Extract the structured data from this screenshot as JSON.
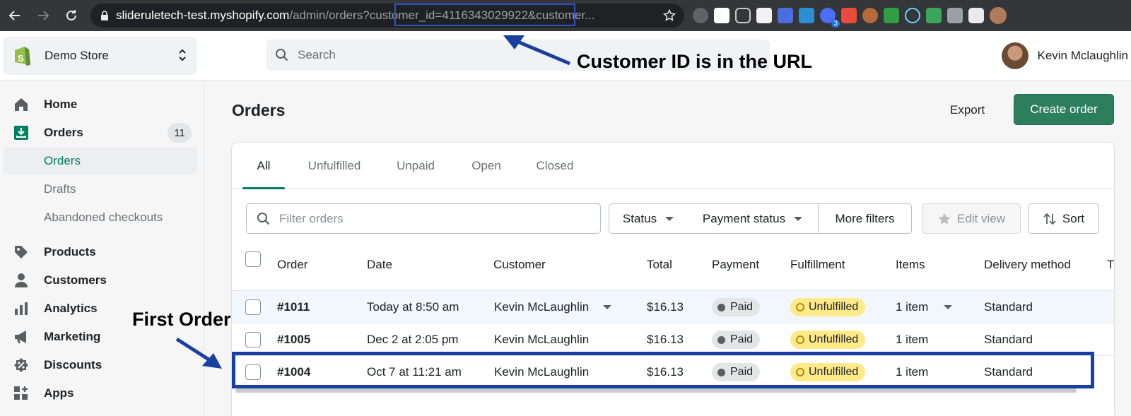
{
  "browser": {
    "url_host": "slideruletech-test.myshopify.com",
    "url_path": "/admin/orders?",
    "url_highlight": "customer_id=4116343029922",
    "url_rest": "&customer...",
    "ext_badge": "3"
  },
  "store": {
    "name": "Demo Store"
  },
  "search": {
    "placeholder": "Search"
  },
  "user": {
    "name": "Kevin Mclaughlin"
  },
  "annotations": {
    "url_note": "Customer ID is in the URL",
    "first_order": "First Order"
  },
  "sidebar": {
    "items": [
      {
        "label": "Home",
        "icon": "home-icon"
      },
      {
        "label": "Orders",
        "icon": "orders-icon",
        "badge": "11"
      },
      {
        "label": "Orders",
        "sub": true,
        "active": true
      },
      {
        "label": "Drafts",
        "sub": true
      },
      {
        "label": "Abandoned checkouts",
        "sub": true
      },
      {
        "label": "Products",
        "icon": "tag-icon"
      },
      {
        "label": "Customers",
        "icon": "person-icon"
      },
      {
        "label": "Analytics",
        "icon": "bar-chart-icon"
      },
      {
        "label": "Marketing",
        "icon": "megaphone-icon"
      },
      {
        "label": "Discounts",
        "icon": "discount-icon"
      },
      {
        "label": "Apps",
        "icon": "apps-icon"
      }
    ]
  },
  "page": {
    "title": "Orders",
    "export_label": "Export",
    "create_label": "Create order"
  },
  "tabs": [
    "All",
    "Unfulfilled",
    "Unpaid",
    "Open",
    "Closed"
  ],
  "filters": {
    "placeholder": "Filter orders",
    "status": "Status",
    "payment_status": "Payment status",
    "more_filters": "More filters",
    "edit_view": "Edit view",
    "sort": "Sort"
  },
  "table": {
    "headers": [
      "Order",
      "Date",
      "Customer",
      "Total",
      "Payment",
      "Fulfillment",
      "Items",
      "Delivery method",
      "T"
    ],
    "rows": [
      {
        "order": "#1011",
        "date": "Today at 8:50 am",
        "customer": "Kevin McLaughlin",
        "total": "$16.13",
        "payment": "Paid",
        "fulfillment": "Unfulfilled",
        "items": "1 item",
        "delivery": "Standard"
      },
      {
        "order": "#1005",
        "date": "Dec 2 at 2:05 pm",
        "customer": "Kevin McLaughlin",
        "total": "$16.13",
        "payment": "Paid",
        "fulfillment": "Unfulfilled",
        "items": "1 item",
        "delivery": "Standard"
      },
      {
        "order": "#1004",
        "date": "Oct 7 at 11:21 am",
        "customer": "Kevin McLaughlin",
        "total": "$16.13",
        "payment": "Paid",
        "fulfillment": "Unfulfilled",
        "items": "1 item",
        "delivery": "Standard"
      }
    ]
  },
  "colors": {
    "primary": "#2d7e5f",
    "annotation": "#193fa0",
    "active_nav": "#007f5f",
    "unfulfilled_bg": "#ffea8a"
  }
}
